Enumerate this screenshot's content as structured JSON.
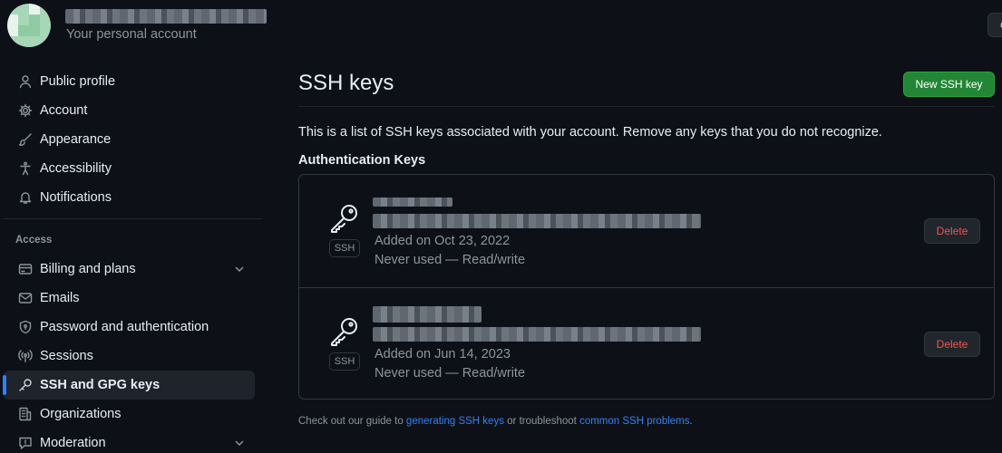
{
  "header": {
    "account_subtitle": "Your personal account",
    "go_button_label": "G"
  },
  "sidebar": {
    "items_top": [
      {
        "label": "Public profile",
        "icon": "person-icon"
      },
      {
        "label": "Account",
        "icon": "gear-icon"
      },
      {
        "label": "Appearance",
        "icon": "paintbrush-icon"
      },
      {
        "label": "Accessibility",
        "icon": "accessibility-icon"
      },
      {
        "label": "Notifications",
        "icon": "bell-icon"
      }
    ],
    "access_heading": "Access",
    "items_access": [
      {
        "label": "Billing and plans",
        "icon": "credit-card-icon",
        "expandable": true
      },
      {
        "label": "Emails",
        "icon": "mail-icon"
      },
      {
        "label": "Password and authentication",
        "icon": "shield-lock-icon"
      },
      {
        "label": "Sessions",
        "icon": "broadcast-icon"
      },
      {
        "label": "SSH and GPG keys",
        "icon": "key-icon",
        "active": true
      },
      {
        "label": "Organizations",
        "icon": "organization-icon"
      },
      {
        "label": "Moderation",
        "icon": "report-icon",
        "expandable": true
      }
    ]
  },
  "main": {
    "title": "SSH keys",
    "new_key_button": "New SSH key",
    "description": "This is a list of SSH keys associated with your account. Remove any keys that you do not recognize.",
    "section_heading": "Authentication Keys",
    "keys": [
      {
        "badge": "SSH",
        "added": "Added on Oct 23, 2022",
        "usage": "Never used — Read/write",
        "delete_label": "Delete"
      },
      {
        "badge": "SSH",
        "added": "Added on Jun 14, 2023",
        "usage": "Never used — Read/write",
        "delete_label": "Delete"
      }
    ],
    "footer": {
      "prefix": "Check out our guide to ",
      "link1": "generating SSH keys",
      "middle": " or troubleshoot ",
      "link2": "common SSH problems",
      "suffix": "."
    }
  },
  "colors": {
    "background": "#0d1117",
    "primary_button": "#238636",
    "danger_text": "#f85149",
    "link": "#2f81f7",
    "active_indicator": "#2f81f7"
  }
}
